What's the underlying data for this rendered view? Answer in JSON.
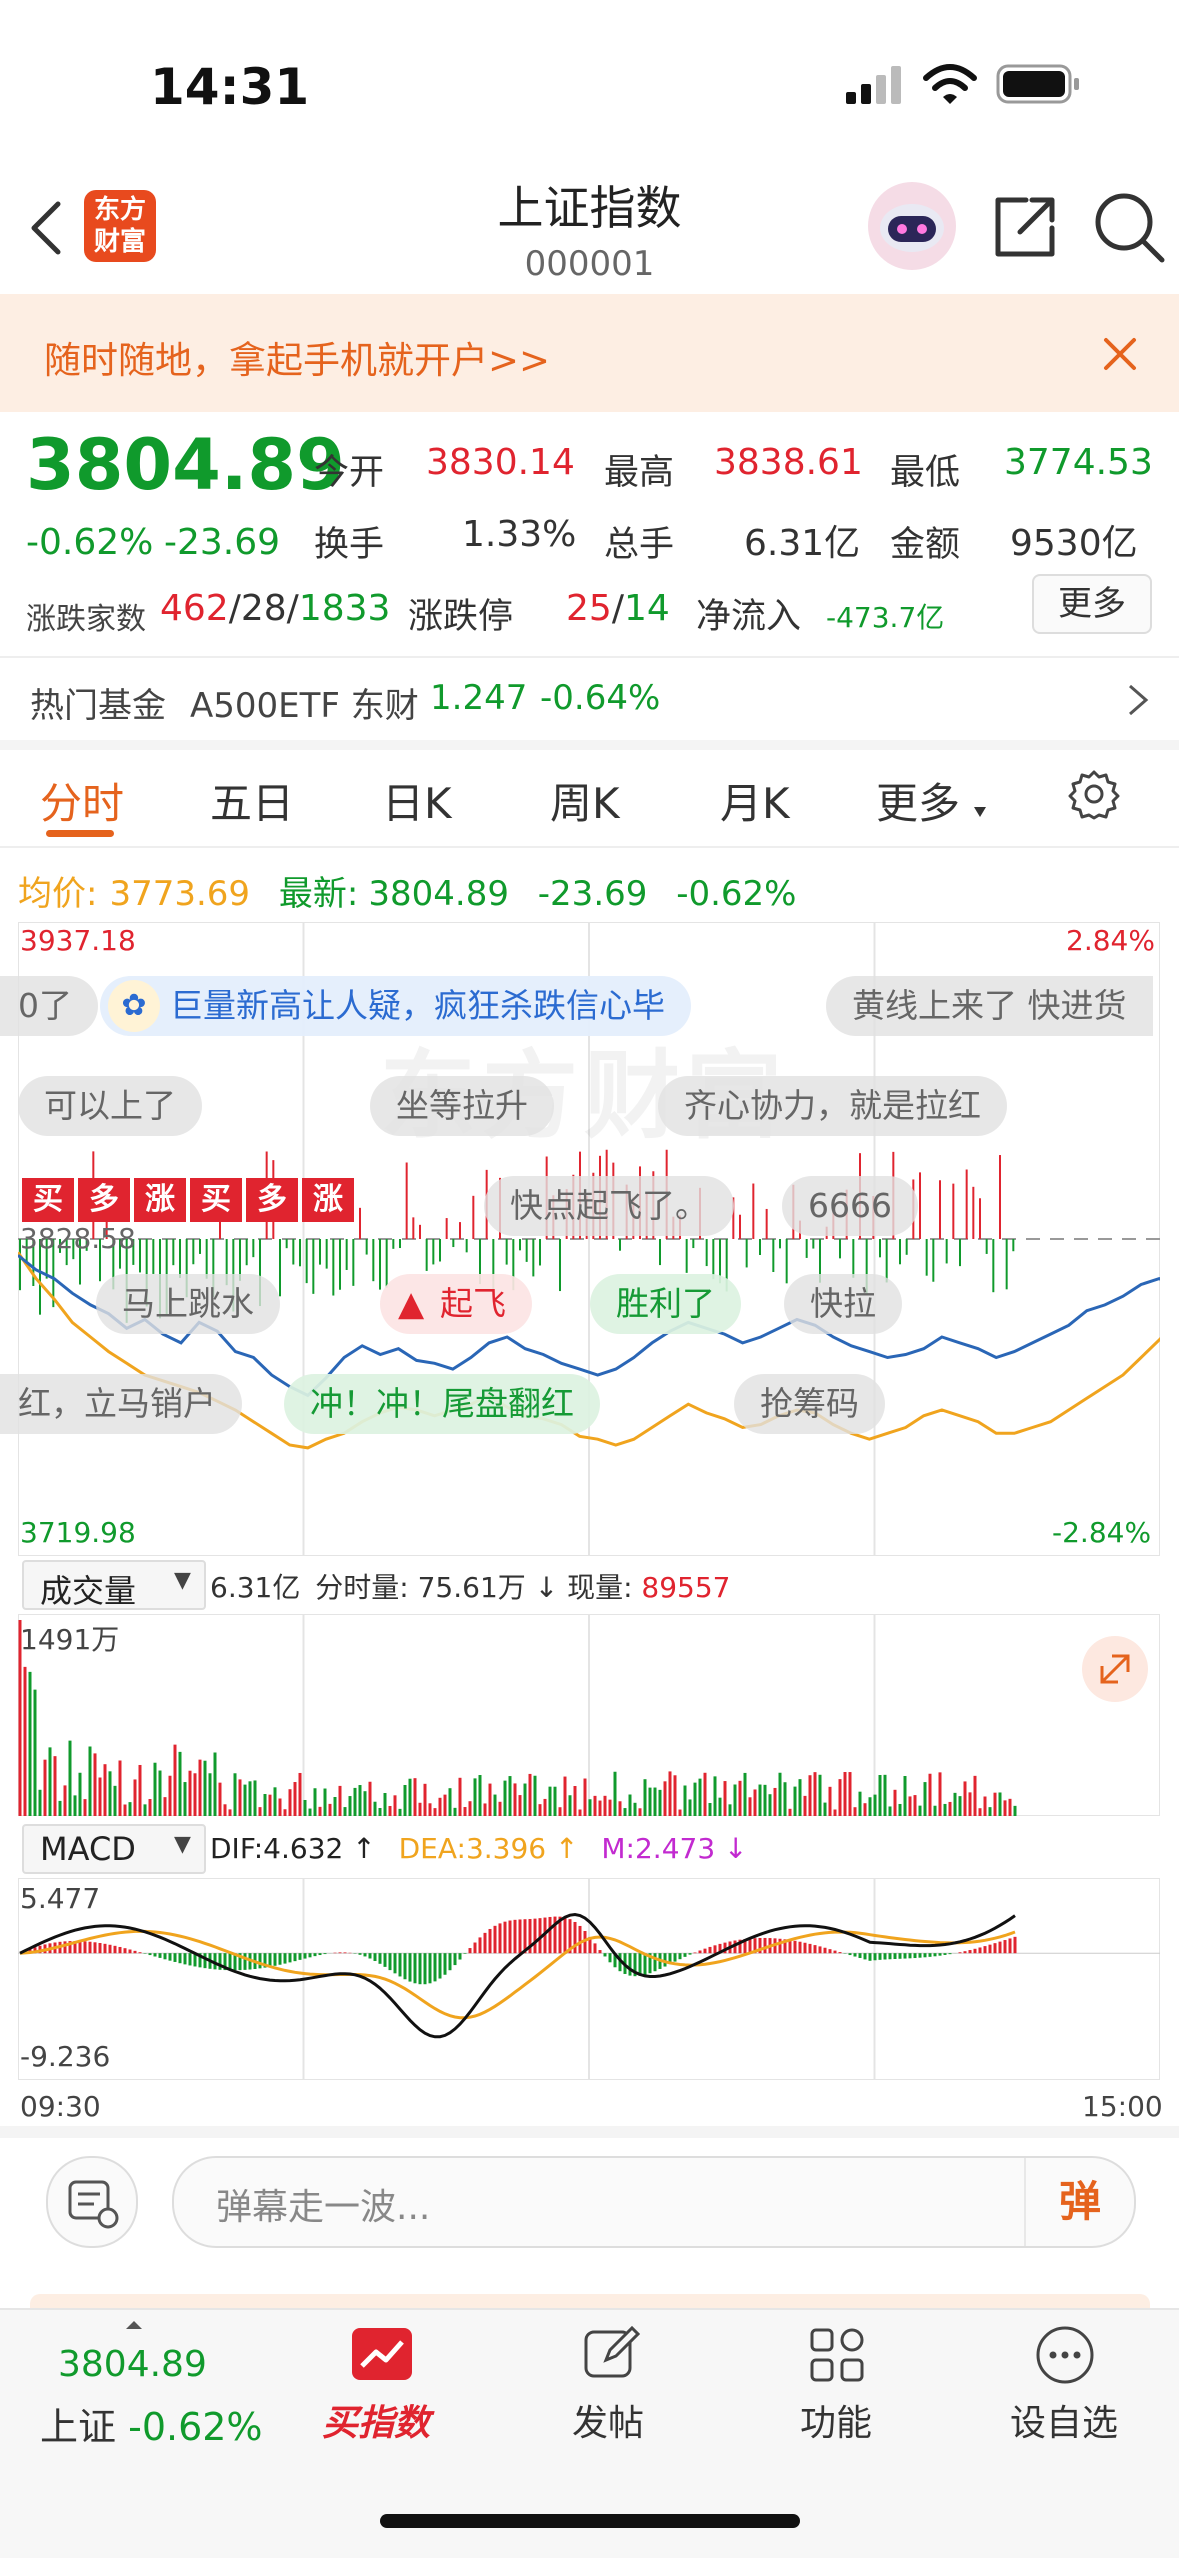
{
  "status_bar": {
    "time": "14:31"
  },
  "header": {
    "logo_text_1": "东方",
    "logo_text_2": "财富",
    "title": "上证指数",
    "code": "000001"
  },
  "banner": {
    "text": "随时随地，拿起手机就开户>>"
  },
  "quote": {
    "price": "3804.89",
    "change_pct": "-0.62%",
    "change": "-23.69",
    "open_label": "今开",
    "open": "3830.14",
    "high_label": "最高",
    "high": "3838.61",
    "low_label": "最低",
    "low": "3774.53",
    "turnover_label": "换手",
    "turnover": "1.33%",
    "vol_label": "总手",
    "vol": "6.31亿",
    "amount_label": "金额",
    "amount": "9530亿",
    "breadth_label": "涨跌家数",
    "up": "462",
    "flat": "28",
    "down": "1833",
    "limit_label": "涨跌停",
    "limit_up": "25",
    "limit_down": "14",
    "inflow_label": "净流入",
    "inflow": "-473.7亿",
    "more": "更多"
  },
  "hot_fund": {
    "label": "热门基金",
    "name": "A500ETF 东财",
    "price": "1.247",
    "pct": "-0.64%"
  },
  "tabs": [
    "分时",
    "五日",
    "日K",
    "周K",
    "月K",
    "更多"
  ],
  "tab_active": "分时",
  "intraday": {
    "avg_label": "均价:",
    "avg": "3773.69",
    "latest_label": "最新:",
    "latest": "3804.89",
    "chg": "-23.69",
    "pct": "-0.62%",
    "ymax": "3937.18",
    "ymin": "3719.98",
    "yprev": "3828.58",
    "pct_max": "2.84%",
    "pct_min": "-2.84%",
    "watermark": "东方财富",
    "price_series": [
      3823,
      3818,
      3815,
      3810,
      3806,
      3803,
      3798,
      3801,
      3796,
      3793,
      3800,
      3797,
      3790,
      3788,
      3782,
      3778,
      3775,
      3781,
      3788,
      3792,
      3789,
      3791,
      3787,
      3786,
      3784,
      3788,
      3793,
      3795,
      3791,
      3789,
      3786,
      3784,
      3782,
      3784,
      3788,
      3793,
      3797,
      3800,
      3798,
      3796,
      3793,
      3795,
      3798,
      3801,
      3799,
      3795,
      3792,
      3790,
      3788,
      3789,
      3791,
      3795,
      3793,
      3791,
      3788,
      3790,
      3793,
      3796,
      3799,
      3804,
      3806,
      3809,
      3813,
      3815,
      3812
    ],
    "avg_series": [
      3824,
      3815,
      3808,
      3800,
      3795,
      3790,
      3786,
      3782,
      3780,
      3778,
      3776,
      3773,
      3770,
      3766,
      3762,
      3758,
      3757,
      3760,
      3762,
      3766,
      3769,
      3771,
      3770,
      3768,
      3770,
      3772,
      3775,
      3771,
      3768,
      3767,
      3765,
      3761,
      3760,
      3758,
      3760,
      3764,
      3768,
      3772,
      3769,
      3767,
      3764,
      3765,
      3768,
      3770,
      3769,
      3765,
      3762,
      3760,
      3762,
      3764,
      3768,
      3770,
      3768,
      3766,
      3762,
      3762,
      3764,
      3766,
      3770,
      3774,
      3778,
      3782,
      3788,
      3794,
      3800
    ],
    "danmaku": [
      "0了",
      "巨量新高让人疑，疯狂杀跌信心毕",
      "黄线上来了  快进货",
      "可以上了",
      "坐等拉升",
      "齐心协力，就是拉红",
      "快点起飞了。",
      "6666",
      "马上跳水",
      "起飞",
      "胜利了",
      "快拉",
      "红，立马销户",
      "冲！冲！尾盘翻红",
      "抢筹码"
    ],
    "buy_tags": [
      "买",
      "多",
      "涨",
      "买",
      "多",
      "涨"
    ]
  },
  "volume": {
    "label": "成交量",
    "total": "6.31亿",
    "detail_label": "分时量:",
    "detail": "75.61万",
    "arrow": "↓",
    "now_label": "现量:",
    "now": "89557",
    "ymax": "1491万"
  },
  "macd": {
    "label": "MACD",
    "dif": "DIF:4.632 ↑",
    "dea": "DEA:3.396 ↑",
    "m": "M:2.473 ↓",
    "ymax": "5.477",
    "ymin": "-9.236",
    "t_start": "09:30",
    "t_end": "15:00"
  },
  "comment": {
    "placeholder": "弹幕走一波...",
    "send": "弹"
  },
  "bottom_nav": {
    "price": "3804.89",
    "name": "上证",
    "pct": "-0.62%",
    "items": [
      "买指数",
      "发帖",
      "功能",
      "设自选"
    ]
  },
  "colors": {
    "red": "#e0242f",
    "green": "#109a2c",
    "gold": "#f0a41e",
    "blue": "#2a66b6",
    "orange": "#e5631d"
  }
}
